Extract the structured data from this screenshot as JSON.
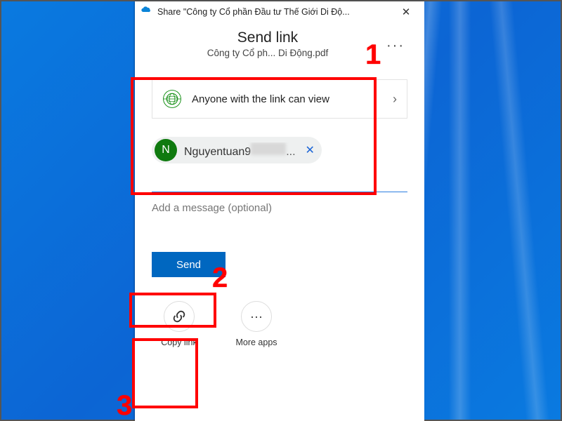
{
  "window": {
    "title": "Share \"Công ty Cổ phần Đầu tư Thế Giới Di Độ...",
    "close_glyph": "✕"
  },
  "header": {
    "title": "Send link",
    "filename": "Công ty Cổ ph... Di Động.pdf",
    "more_glyph": "···"
  },
  "permission": {
    "text": "Anyone with the link can view",
    "chevron": "›"
  },
  "recipient": {
    "initial": "N",
    "name_visible": "Nguyentuan9",
    "ellipsis": "...",
    "remove_glyph": "✕"
  },
  "message": {
    "placeholder": "Add a message (optional)"
  },
  "buttons": {
    "send": "Send"
  },
  "actions": {
    "copy_link": "Copy link",
    "more_apps": "More apps",
    "link_glyph": "🔗",
    "more_glyph": "···"
  },
  "annotations": {
    "n1": "1",
    "n2": "2",
    "n3": "3"
  }
}
